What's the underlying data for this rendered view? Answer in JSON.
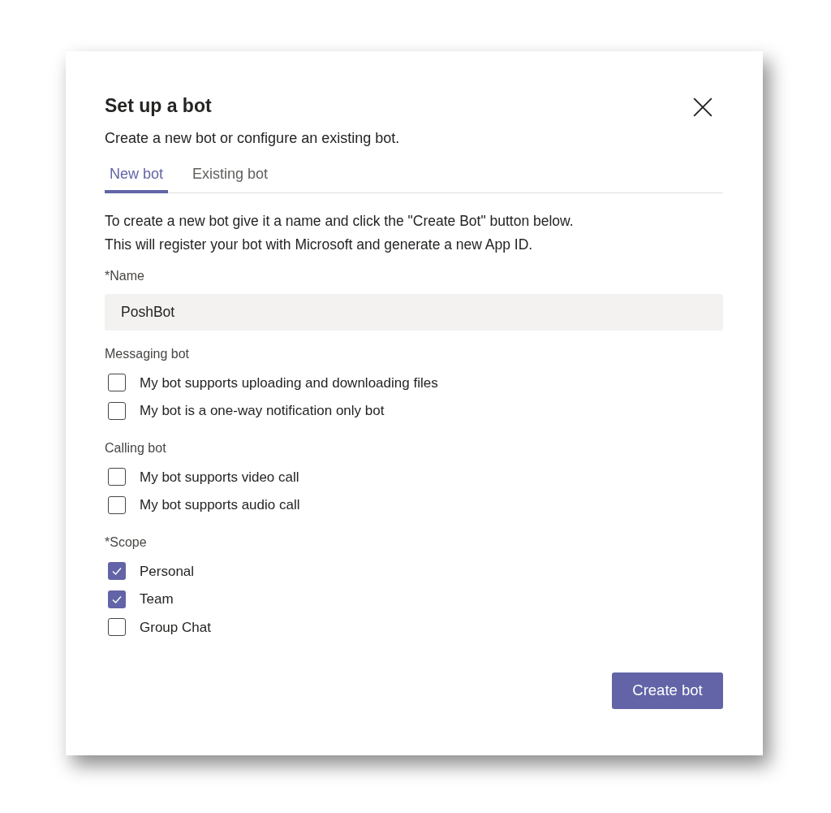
{
  "dialog": {
    "title": "Set up a bot",
    "subtitle": "Create a new bot or configure an existing bot.",
    "tabs": [
      {
        "label": "New bot",
        "selected": true
      },
      {
        "label": "Existing bot",
        "selected": false
      }
    ],
    "description": "To create a new bot give it a name and click the \"Create Bot\" button below. This will register your bot with Microsoft and generate a new App ID.",
    "name_field": {
      "label": "*Name",
      "value": "PoshBot"
    },
    "sections": [
      {
        "heading": "Messaging bot",
        "options": [
          {
            "label": "My bot supports uploading and downloading files",
            "checked": false
          },
          {
            "label": "My bot is a one-way notification only bot",
            "checked": false
          }
        ]
      },
      {
        "heading": "Calling bot",
        "options": [
          {
            "label": "My bot supports video call",
            "checked": false
          },
          {
            "label": "My bot supports audio call",
            "checked": false
          }
        ]
      },
      {
        "heading": "*Scope",
        "options": [
          {
            "label": "Personal",
            "checked": true
          },
          {
            "label": "Team",
            "checked": true
          },
          {
            "label": "Group Chat",
            "checked": false
          }
        ]
      }
    ],
    "primary_button": "Create bot"
  }
}
